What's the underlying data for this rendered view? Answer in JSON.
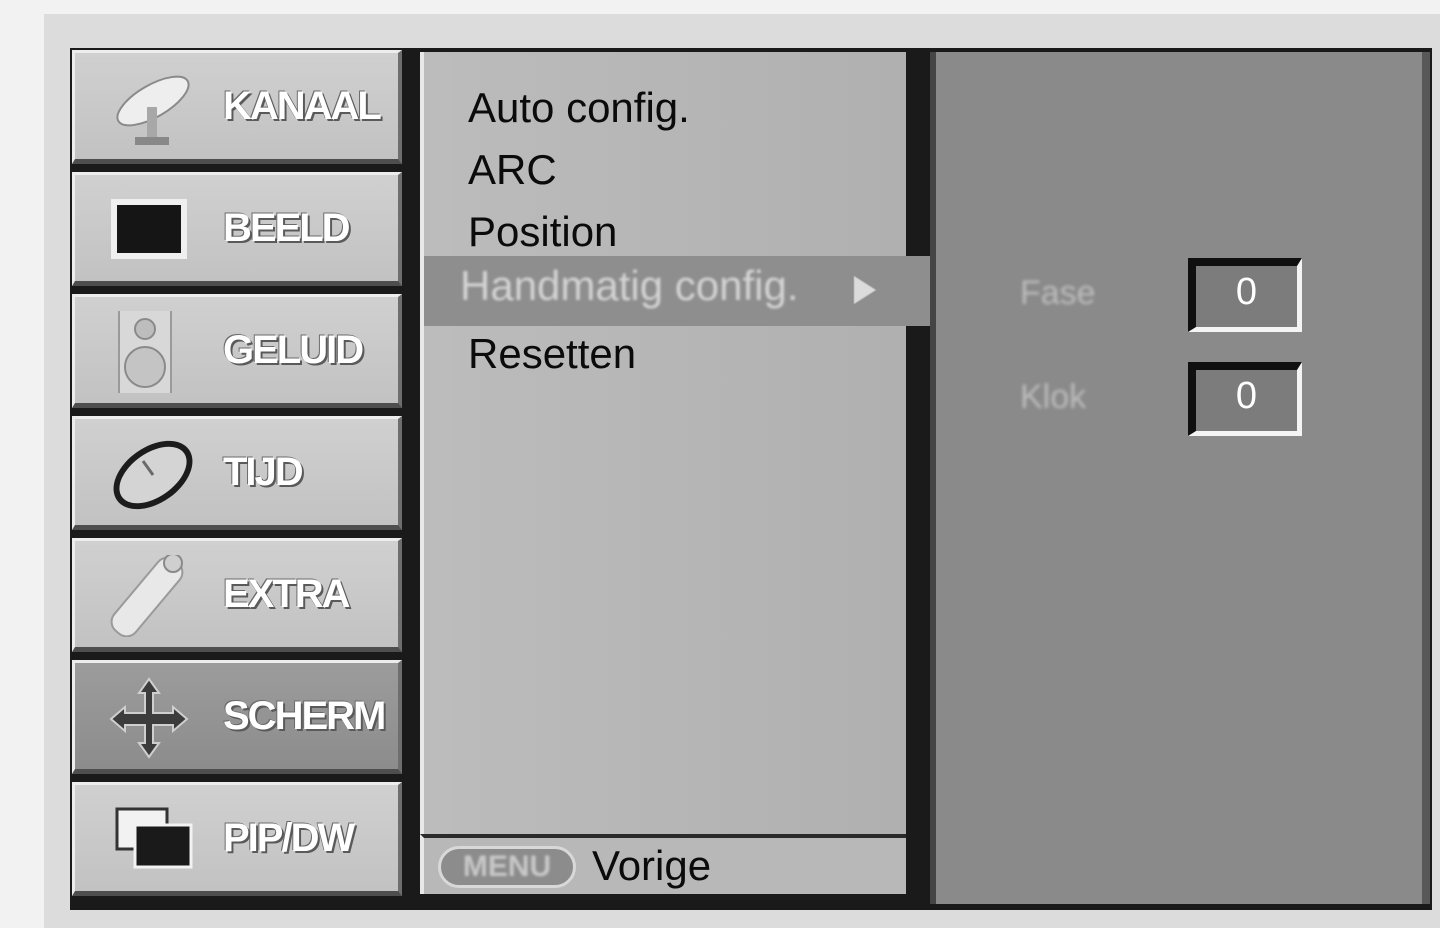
{
  "categories": [
    {
      "label": "KANAAL",
      "icon": "satellite-dish-icon",
      "active": false
    },
    {
      "label": "BEELD",
      "icon": "tv-screen-icon",
      "active": false
    },
    {
      "label": "GELUID",
      "icon": "speaker-icon",
      "active": false
    },
    {
      "label": "TIJD",
      "icon": "clock-icon",
      "active": false
    },
    {
      "label": "EXTRA",
      "icon": "remote-control-icon",
      "active": false
    },
    {
      "label": "SCHERM",
      "icon": "move-arrows-icon",
      "active": true
    },
    {
      "label": "PIP/DW",
      "icon": "pip-windows-icon",
      "active": false
    }
  ],
  "menu": {
    "items": [
      "Auto config.",
      "ARC",
      "Position",
      "Handmatig config.",
      "Resetten"
    ],
    "selected_index": 3,
    "footer_key": "MENU",
    "footer_label": "Vorige"
  },
  "panel": {
    "params": [
      {
        "label": "Fase",
        "value": "0"
      },
      {
        "label": "Klok",
        "value": "0"
      }
    ]
  },
  "colors": {
    "category_bg": "#c8c8c8",
    "category_active_bg": "#949494",
    "menu_bg": "#b6b6b6",
    "highlight_bg": "#8e8e8e",
    "panel_bg": "#8a8a8a"
  }
}
